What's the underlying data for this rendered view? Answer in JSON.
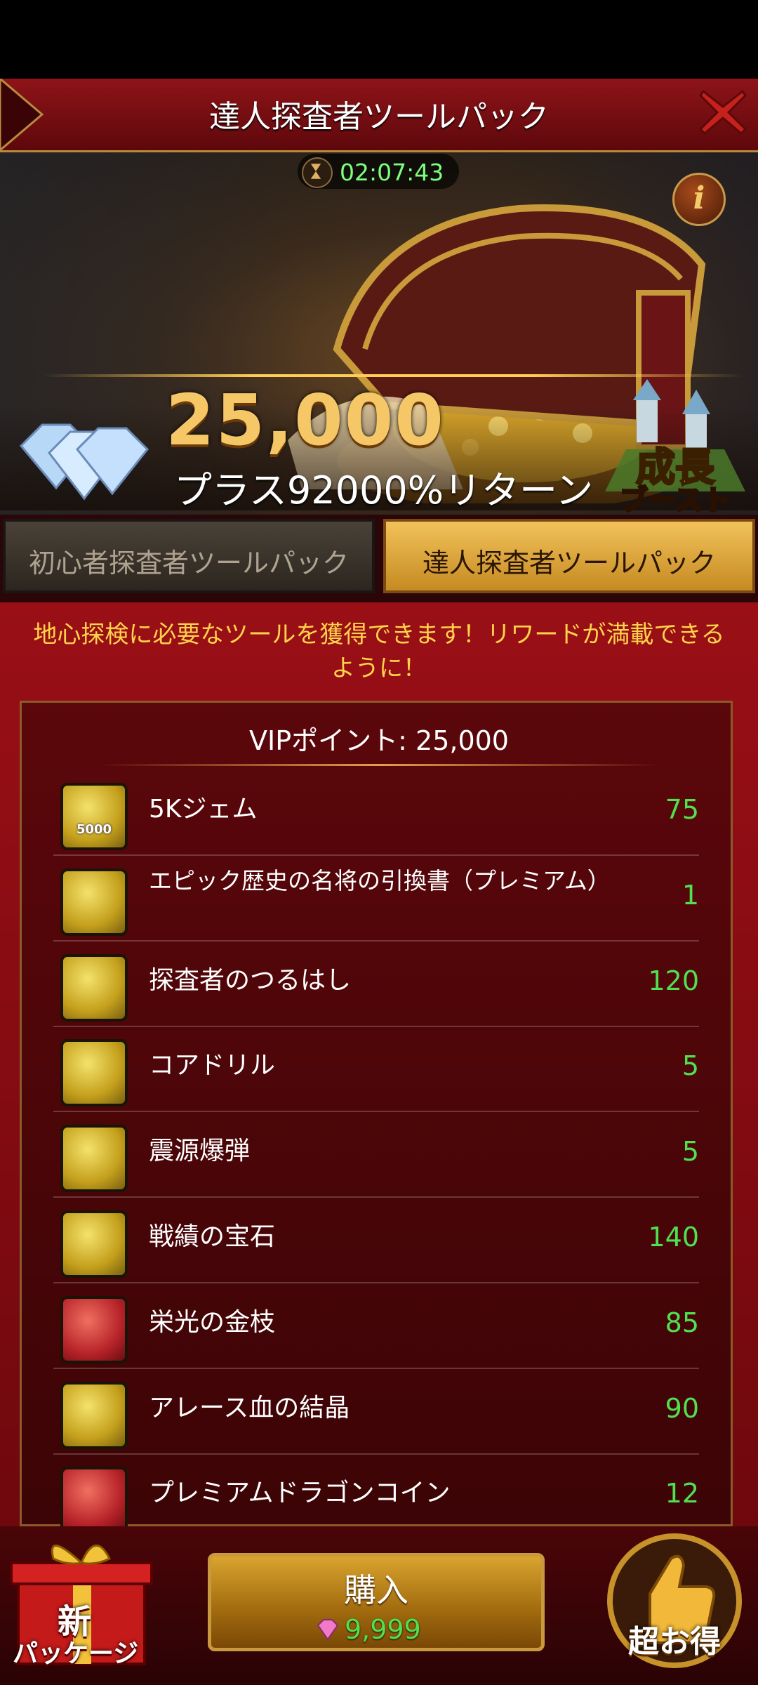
{
  "window": {
    "title": "達人探査者ツールパック"
  },
  "timer": "02:07:43",
  "hero": {
    "amount": "25,000",
    "bonus": "プラス92000%リターン",
    "growth_badge": [
      "成長",
      "ブースト"
    ]
  },
  "tabs": [
    {
      "label": "初心者探査者ツールパック",
      "selected": false
    },
    {
      "label": "達人探査者ツールパック",
      "selected": true
    }
  ],
  "description": "地心探検に必要なツールを獲得できます！リワードが満載できるように！",
  "vip": "VIPポイント: 25,000",
  "items": [
    {
      "name": "5Kジェム",
      "qty": "75",
      "icon": "gem-5000-icon",
      "frame": "gold",
      "badge": "5000"
    },
    {
      "name": "エピック歴史の名将の引換書（プレミアム）",
      "qty": "1",
      "icon": "scroll-icon",
      "frame": "gold"
    },
    {
      "name": "探査者のつるはし",
      "qty": "120",
      "icon": "pickaxe-icon",
      "frame": "gold"
    },
    {
      "name": "コアドリル",
      "qty": "5",
      "icon": "drill-icon",
      "frame": "gold"
    },
    {
      "name": "震源爆弾",
      "qty": "5",
      "icon": "dynamite-icon",
      "frame": "gold"
    },
    {
      "name": "戦績の宝石",
      "qty": "140",
      "icon": "green-gem-icon",
      "frame": "gold"
    },
    {
      "name": "栄光の金枝",
      "qty": "85",
      "icon": "golden-branch-icon",
      "frame": "red"
    },
    {
      "name": "アレース血の結晶",
      "qty": "90",
      "icon": "blood-crystal-icon",
      "frame": "gold"
    },
    {
      "name": "プレミアムドラゴンコイン",
      "qty": "12",
      "icon": "dragon-coin-icon",
      "frame": "red"
    }
  ],
  "buy": {
    "label": "購入",
    "price": "9,999"
  },
  "new_package": {
    "line1": "新",
    "line2": "パッケージ"
  },
  "deal": {
    "label": "超お得"
  },
  "colors": {
    "accent_gold": "#f6c766",
    "quantity_green": "#50e050",
    "banner_red": "#7a0b10"
  }
}
